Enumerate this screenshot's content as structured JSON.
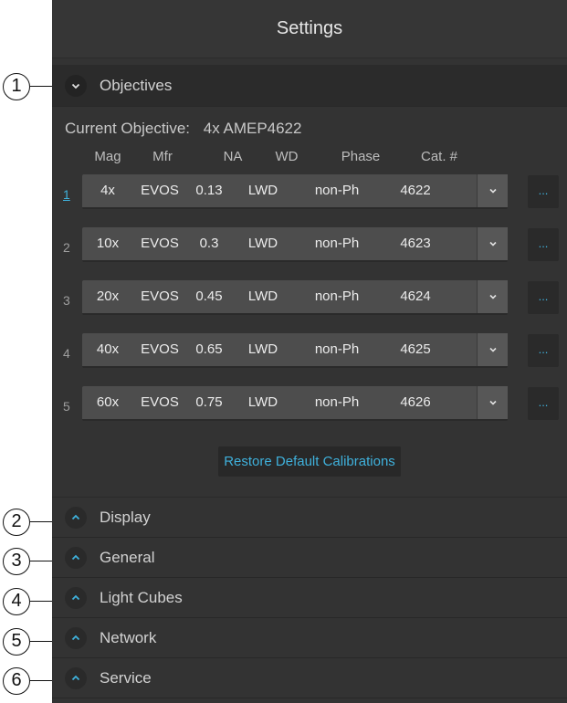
{
  "title": "Settings",
  "callouts": [
    "1",
    "2",
    "3",
    "4",
    "5",
    "6"
  ],
  "objectives": {
    "label": "Objectives",
    "current_label": "Current Objective:",
    "current_value": "4x AMEP4622",
    "columns": [
      "Mag",
      "Mfr",
      "NA",
      "WD",
      "Phase",
      "Cat. #"
    ],
    "rows": [
      {
        "index": "1",
        "mag": "4x",
        "mfr": "EVOS",
        "na": "0.13",
        "wd": "LWD",
        "phase": "non-Ph",
        "cat": "4622",
        "more": "..."
      },
      {
        "index": "2",
        "mag": "10x",
        "mfr": "EVOS",
        "na": "0.3",
        "wd": "LWD",
        "phase": "non-Ph",
        "cat": "4623",
        "more": "..."
      },
      {
        "index": "3",
        "mag": "20x",
        "mfr": "EVOS",
        "na": "0.45",
        "wd": "LWD",
        "phase": "non-Ph",
        "cat": "4624",
        "more": "..."
      },
      {
        "index": "4",
        "mag": "40x",
        "mfr": "EVOS",
        "na": "0.65",
        "wd": "LWD",
        "phase": "non-Ph",
        "cat": "4625",
        "more": "..."
      },
      {
        "index": "5",
        "mag": "60x",
        "mfr": "EVOS",
        "na": "0.75",
        "wd": "LWD",
        "phase": "non-Ph",
        "cat": "4626",
        "more": "..."
      }
    ],
    "restore_label": "Restore Default Calibrations"
  },
  "sections": [
    {
      "label": "Display"
    },
    {
      "label": "General"
    },
    {
      "label": "Light Cubes"
    },
    {
      "label": "Network"
    },
    {
      "label": "Service"
    }
  ],
  "colors": {
    "panel_bg": "#333333",
    "row_bg": "#4d4d4d",
    "accent": "#3fb1dc",
    "text": "#d2d2d2"
  },
  "icons": {
    "expanded": "chevron-down-icon",
    "collapsed": "chevron-up-icon",
    "more": "ellipsis-icon"
  }
}
